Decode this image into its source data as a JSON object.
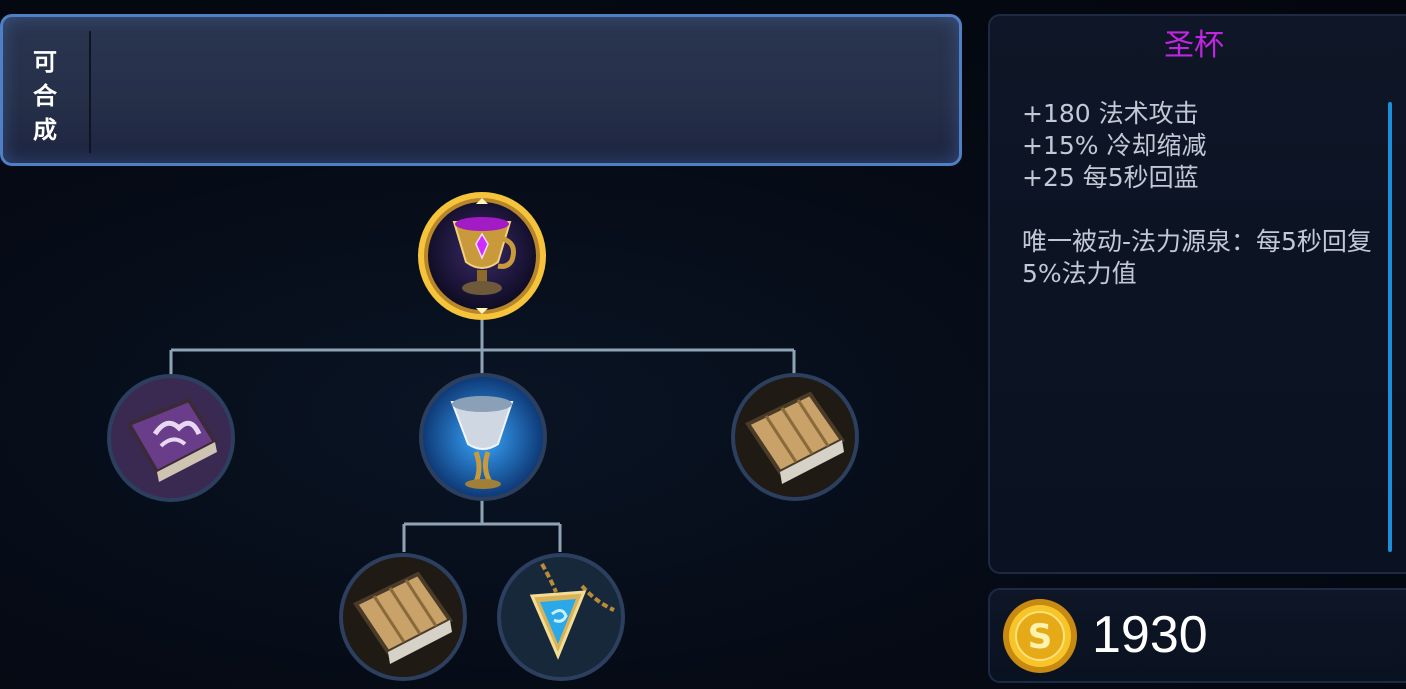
{
  "craft_panel": {
    "label": "可\n合\n成"
  },
  "item": {
    "name": "圣杯",
    "stats": [
      "+180 法术攻击",
      "+15% 冷却缩减",
      "+25 每5秒回蓝"
    ],
    "passive": "唯一被动-法力源泉：每5秒回复5%法力值",
    "price": "1930"
  },
  "tree": {
    "root": {
      "icon": "holy-grail-icon",
      "selected": true
    },
    "children": [
      {
        "icon": "arcane-book-icon"
      },
      {
        "icon": "blue-goblet-icon"
      },
      {
        "icon": "wooden-book-icon"
      }
    ],
    "grandchildren": [
      {
        "icon": "wooden-book-icon"
      },
      {
        "icon": "blue-pendant-icon"
      }
    ]
  },
  "colors": {
    "accent_border": "#4f7fc4",
    "item_name": "#c025e0",
    "selected_ring": "#f5c43a",
    "scrollbar": "#1d8fd8"
  },
  "icons": {
    "currency": "gold-coin-icon"
  }
}
